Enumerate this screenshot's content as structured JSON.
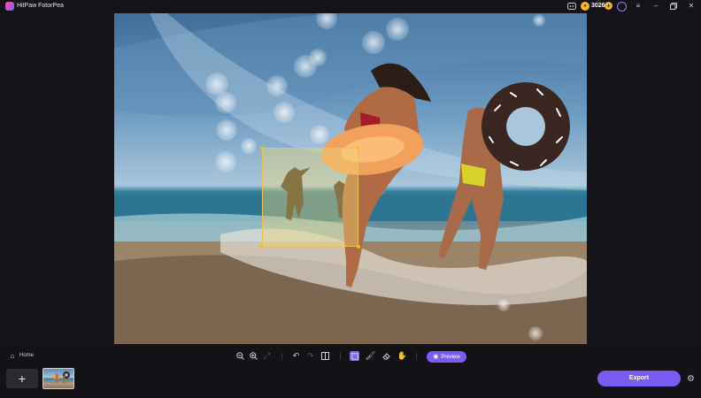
{
  "app": {
    "title": "HitPaw FotorPea"
  },
  "titlebar": {
    "coins": "3026",
    "icons": [
      "discord-icon",
      "coin-icon",
      "plus-icon",
      "user-icon",
      "menu-icon",
      "minimize-icon",
      "restore-icon",
      "close-icon"
    ]
  },
  "nav": {
    "home_label": "Home"
  },
  "toolbar": {
    "preview_label": "Preview",
    "icons": [
      "zoom-out-icon",
      "zoom-in-icon",
      "fit-screen-icon",
      "undo-icon",
      "redo-icon",
      "compare-icon",
      "rect-select-icon",
      "brush-icon",
      "eraser-icon",
      "hand-icon"
    ],
    "active_tool": "rect-select-icon"
  },
  "bottom": {
    "add_label": "+",
    "export_label": "Export"
  },
  "colors": {
    "accent": "#7b5cf0",
    "selection": "#e9c35a",
    "background": "#121217"
  }
}
